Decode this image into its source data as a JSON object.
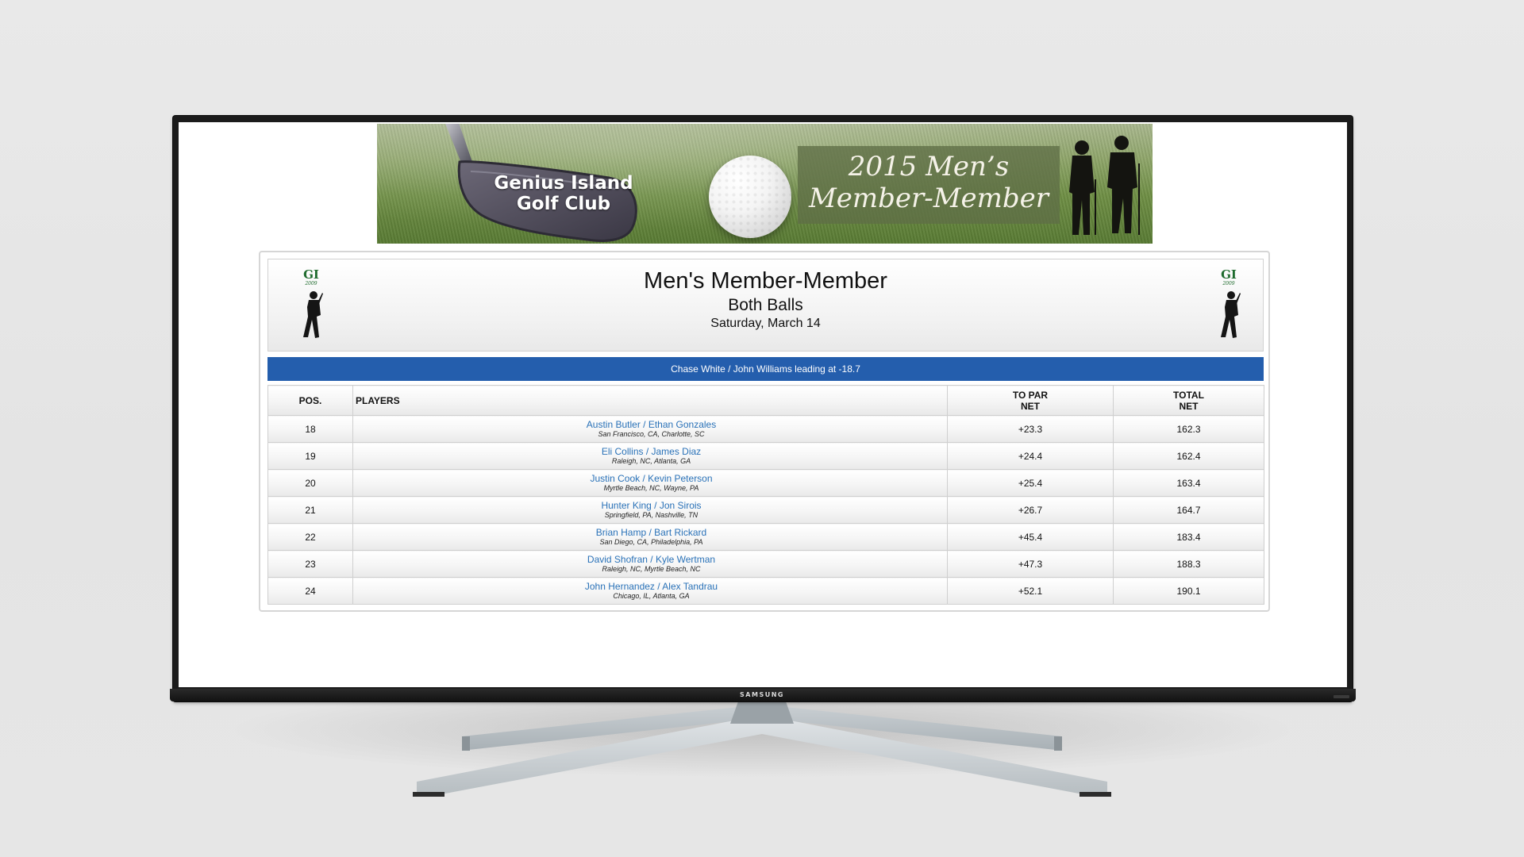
{
  "device": {
    "brand": "SAMSUNG"
  },
  "banner": {
    "club_name_line1": "Genius Island",
    "club_name_line2": "Golf Club",
    "event_line1": "2015 Men’s",
    "event_line2": "Member-Member"
  },
  "header": {
    "logo_text": "GI",
    "logo_year": "2009",
    "title": "Men's Member-Member",
    "subtitle": "Both Balls",
    "date": "Saturday, March 14"
  },
  "leader_message": "Chase White / John Williams leading at -18.7",
  "table": {
    "columns": {
      "pos": "POS.",
      "players": "PLAYERS",
      "to_par_line1": "TO PAR",
      "to_par_line2": "NET",
      "total_line1": "TOTAL",
      "total_line2": "NET"
    },
    "rows": [
      {
        "pos": "18",
        "players": "Austin Butler / Ethan Gonzales",
        "cities": "San Francisco, CA, Charlotte, SC",
        "to_par": "+23.3",
        "total": "162.3"
      },
      {
        "pos": "19",
        "players": "Eli Collins / James Diaz",
        "cities": "Raleigh, NC, Atlanta, GA",
        "to_par": "+24.4",
        "total": "162.4"
      },
      {
        "pos": "20",
        "players": "Justin Cook / Kevin Peterson",
        "cities": "Myrtle Beach, NC, Wayne, PA",
        "to_par": "+25.4",
        "total": "163.4"
      },
      {
        "pos": "21",
        "players": "Hunter King / Jon Sirois",
        "cities": "Springfield, PA, Nashville, TN",
        "to_par": "+26.7",
        "total": "164.7"
      },
      {
        "pos": "22",
        "players": "Brian Hamp / Bart Rickard",
        "cities": "San Diego, CA, Philadelphia, PA",
        "to_par": "+45.4",
        "total": "183.4"
      },
      {
        "pos": "23",
        "players": "David Shofran / Kyle Wertman",
        "cities": "Raleigh, NC, Myrtle Beach, NC",
        "to_par": "+47.3",
        "total": "188.3"
      },
      {
        "pos": "24",
        "players": "John Hernandez / Alex Tandrau",
        "cities": "Chicago, IL, Atlanta, GA",
        "to_par": "+52.1",
        "total": "190.1"
      }
    ]
  },
  "colors": {
    "leader_bar": "#245ead",
    "player_link": "#2a72b8",
    "logo_green": "#1e6b2d"
  }
}
